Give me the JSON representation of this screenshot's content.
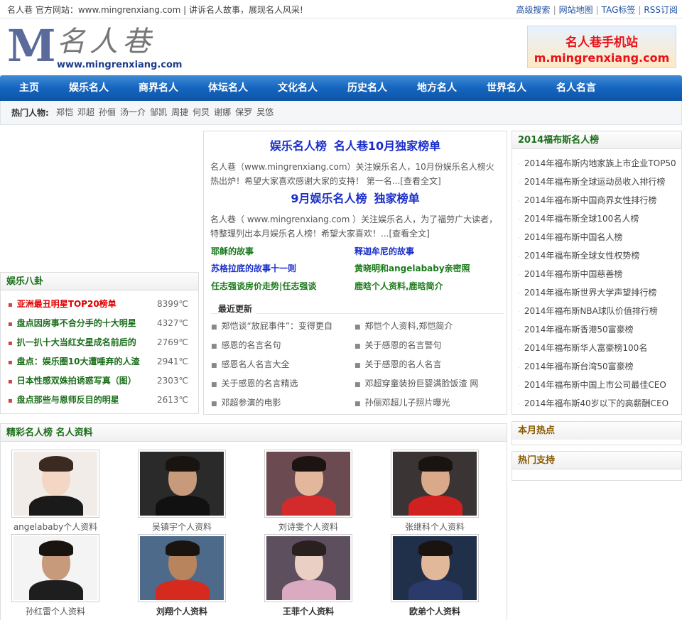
{
  "topbar": {
    "slogan": "名人巷 官方网站：www.mingrenxiang.com | 讲诉名人故事，展现名人风采!",
    "links": [
      "高级搜索",
      "网站地图",
      "TAG标签",
      "RSS订阅"
    ]
  },
  "logo": {
    "letter": "M",
    "name": "名人巷",
    "url": "www.mingrenxiang.com"
  },
  "mobile_banner": {
    "line1": "名人巷手机站",
    "line2": "m.mingrenxiang.com"
  },
  "nav": {
    "items": [
      "主页",
      "娱乐名人",
      "商界名人",
      "体坛名人",
      "文化名人",
      "历史名人",
      "地方名人",
      "世界名人",
      "名人名言"
    ]
  },
  "hot": {
    "label": "热门人物:",
    "names": [
      "郑恺",
      "邓超",
      "孙俪",
      "汤一介",
      "邹凯",
      "周捷",
      "何炅",
      "谢娜",
      "保罗",
      "吴悠"
    ]
  },
  "ent": {
    "title": "娱乐八卦",
    "items": [
      {
        "text": "亚洲最丑明星TOP20榜单",
        "temp": "8399℃",
        "color": "#e00000"
      },
      {
        "text": "盘点因房事不合分手的十大明星",
        "temp": "4327℃",
        "color": "#1b6e1b"
      },
      {
        "text": "扒一扒十大当红女星成名前后的",
        "temp": "2769℃",
        "color": "#1b6e1b"
      },
      {
        "text": "盘点：娱乐圈10大遭唾弃的人渣",
        "temp": "2941℃",
        "color": "#1b6e1b"
      },
      {
        "text": "日本性感双姝拍诱惑写真（图）",
        "temp": "2303℃",
        "color": "#1b6e1b"
      },
      {
        "text": "盘点那些与恩师反目的明星",
        "temp": "2613℃",
        "color": "#1b6e1b"
      }
    ]
  },
  "center": {
    "headline1": {
      "a": "娱乐名人榜",
      "b": "名人巷10月独家榜单"
    },
    "summary1": "名人巷（www.mingrenxiang.com）关注娱乐名人，10月份娱乐名人榜火热出炉！希望大家喜欢感谢大家的支持！ 第一名...[查看全文]",
    "headline2": {
      "a": "9月娱乐名人榜",
      "b": "独家榜单"
    },
    "summary2": "名人巷（ www.mingrenxiang.com ）关注娱乐名人，为了福劳广大读者，特整理列出本月娱乐名人榜！希望大家喜欢！...[查看全文]",
    "stories": [
      {
        "text": "耶稣的故事",
        "color": "#1b7a1b"
      },
      {
        "text": "释迦牟尼的故事",
        "color": "#1a2ec9"
      },
      {
        "text": "苏格拉底的故事十一则",
        "color": "#1a2ec9"
      },
      {
        "text": "黄晓明和angelababy亲密照",
        "color": "#1b7a1b"
      },
      {
        "text": "任志强谈房价走势|任志强谈",
        "color": "#1b7a1b"
      },
      {
        "text": "鹿晗个人资料,鹿晗简介",
        "color": "#1b7a1b"
      }
    ],
    "latest_title": "最近更新",
    "latest": [
      "郑恺谈“放屁事件”：变得更自",
      "郑恺个人资料,郑恺简介",
      "感恩的名言名句",
      "关于感恩的名言警句",
      "感恩名人名言大全",
      "关于感恩的名人名言",
      "关于感恩的名言精选",
      "邓超穿童装扮巨婴满脸饭渣 网",
      "邓超参演的电影",
      "孙俪邓超儿子照片曝光"
    ]
  },
  "forbes": {
    "title": "2014福布斯名人榜",
    "items": [
      "2014年福布斯内地家族上市企业TOP50",
      "2014年福布斯全球运动员收入排行榜",
      "2014年福布斯中国商界女性排行榜",
      "2014年福布斯全球100名人榜",
      "2014年福布斯中国名人榜",
      "2014年福布斯全球女性权势榜",
      "2014年福布斯中国慈善榜",
      "2014年福布斯世界大学声望排行榜",
      "2014年福布斯NBA球队价值排行榜",
      "2014年福布斯香港50富豪榜",
      "2014年福布斯华人富豪榜100名",
      "2014年福布斯台湾50富豪榜",
      "2014年福布斯中国上市公司最佳CEO",
      "2014年福布斯40岁以下的高薪酬CEO"
    ]
  },
  "month_hot": {
    "title": "本月热点"
  },
  "hot_support": {
    "title": "热门支持"
  },
  "gallery": {
    "title": "精彩名人榜 名人资料",
    "items": [
      {
        "caption": "angelababy个人资料",
        "bold": false,
        "bg": "#f2ece8",
        "skin": "#f3d6c4",
        "hair": "#3a2a22",
        "cloth": "#1a1a1a"
      },
      {
        "caption": "吴镇宇个人资料",
        "bold": false,
        "bg": "#2a2a2a",
        "skin": "#c89a7c",
        "hair": "#1a1410",
        "cloth": "#111111"
      },
      {
        "caption": "刘诗雯个人资料",
        "bold": false,
        "bg": "#6b4a52",
        "skin": "#e2b79c",
        "hair": "#1c1412",
        "cloth": "#d32b2b"
      },
      {
        "caption": "张继科个人资料",
        "bold": false,
        "bg": "#3b3434",
        "skin": "#d9a98a",
        "hair": "#1a1410",
        "cloth": "#d02020"
      },
      {
        "caption": "孙红雷个人资料",
        "bold": false,
        "bg": "#f4f4f4",
        "skin": "#c79a7c",
        "hair": "#1a1410",
        "cloth": "#1e1e1e"
      },
      {
        "caption": "刘翔个人资料",
        "bold": true,
        "bg": "#4d6a8a",
        "skin": "#b8845e",
        "hair": "#1a1410",
        "cloth": "#d62a1e"
      },
      {
        "caption": "王菲个人资料",
        "bold": true,
        "bg": "#5e4f5e",
        "skin": "#e9cfc4",
        "hair": "#2a2020",
        "cloth": "#d9aac0"
      },
      {
        "caption": "欧弟个人资料",
        "bold": true,
        "bg": "#20304a",
        "skin": "#e2b89a",
        "hair": "#1a1410",
        "cloth": "#2a3a6a"
      }
    ]
  },
  "colors": {
    "nav": "#1565bf",
    "link_blue": "#1a2ec9",
    "link_green": "#1b6e1b",
    "hot_red": "#e00000"
  }
}
